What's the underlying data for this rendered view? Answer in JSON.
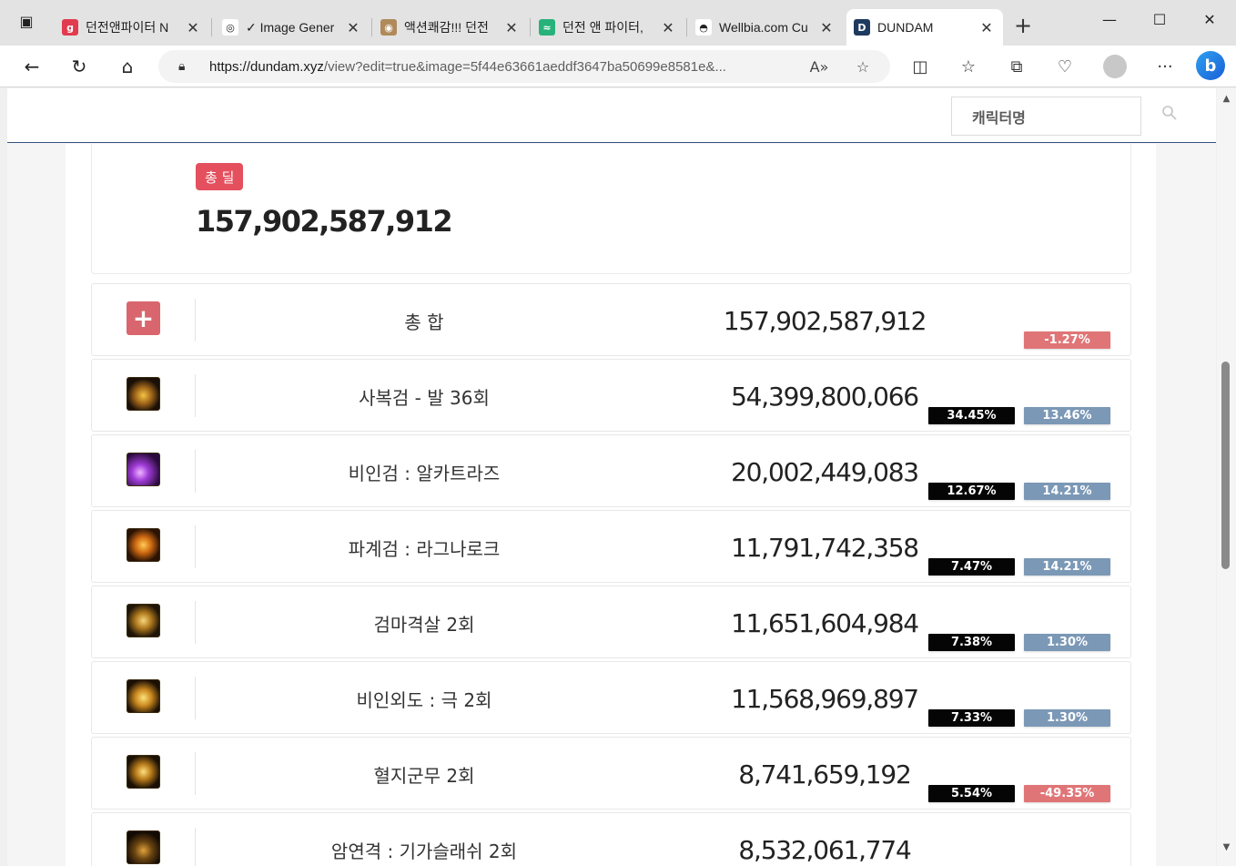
{
  "browser": {
    "tabs": [
      {
        "title": "던전앤파이터 N",
        "icon": "g-icon",
        "icon_color": "#e03b4f",
        "icon_glyph": "g"
      },
      {
        "title": "✓ Image Gener",
        "icon": "openai-icon",
        "icon_color": "#ffffff",
        "icon_glyph": "◎"
      },
      {
        "title": "액션쾌감!!! 던전",
        "icon": "dnf-icon",
        "icon_color": "#b08a5a",
        "icon_glyph": "◉"
      },
      {
        "title": "던전 앤 파이터,",
        "icon": "wave-icon",
        "icon_color": "#27b27a",
        "icon_glyph": "≈"
      },
      {
        "title": "Wellbia.com Cu",
        "icon": "spy-icon",
        "icon_color": "#ffffff",
        "icon_glyph": "◓"
      },
      {
        "title": "DUNDAM",
        "icon": "dundam-icon",
        "icon_color": "#1f3a5f",
        "icon_glyph": "D"
      }
    ],
    "url_host": "https://dundam.xyz",
    "url_path": "/view?edit=true&image=5f44e63661aeddf3647ba50699e8581e&..."
  },
  "header": {
    "search_placeholder": "캐릭터명"
  },
  "summary": {
    "badge": "총 딜",
    "total_damage": "157,902,587,912"
  },
  "rows": [
    {
      "name": "총 합",
      "damage": "157,902,587,912",
      "share": "",
      "diff": "-1.27%",
      "diff_color": "#e07577",
      "icon": "plus-icon",
      "is_total": true
    },
    {
      "name": "사복검 - 발 36회",
      "damage": "54,399,800,066",
      "share": "34.45%",
      "diff": "13.46%",
      "diff_color": "#7b98b6",
      "icon": "skill-icon-gold-crown"
    },
    {
      "name": "비인검 : 알카트라즈",
      "damage": "20,002,449,083",
      "share": "12.67%",
      "diff": "14.21%",
      "diff_color": "#7b98b6",
      "icon": "skill-icon-purple-slash"
    },
    {
      "name": "파계검 : 라그나로크",
      "damage": "11,791,742,358",
      "share": "7.47%",
      "diff": "14.21%",
      "diff_color": "#7b98b6",
      "icon": "skill-icon-fire-sword"
    },
    {
      "name": "검마격살 2회",
      "damage": "11,651,604,984",
      "share": "7.38%",
      "diff": "1.30%",
      "diff_color": "#7b98b6",
      "icon": "skill-icon-dragon"
    },
    {
      "name": "비인외도 : 극 2회",
      "damage": "11,568,969,897",
      "share": "7.33%",
      "diff": "1.30%",
      "diff_color": "#7b98b6",
      "icon": "skill-icon-burst"
    },
    {
      "name": "혈지군무 2회",
      "damage": "8,741,659,192",
      "share": "5.54%",
      "diff": "-49.35%",
      "diff_color": "#e07577",
      "icon": "skill-icon-swirl"
    },
    {
      "name": "암연격 : 기가슬래쉬 2회",
      "damage": "8,532,061,774",
      "share": "",
      "diff": "",
      "diff_color": "#7b98b6",
      "icon": "skill-icon-dark-slash"
    }
  ]
}
